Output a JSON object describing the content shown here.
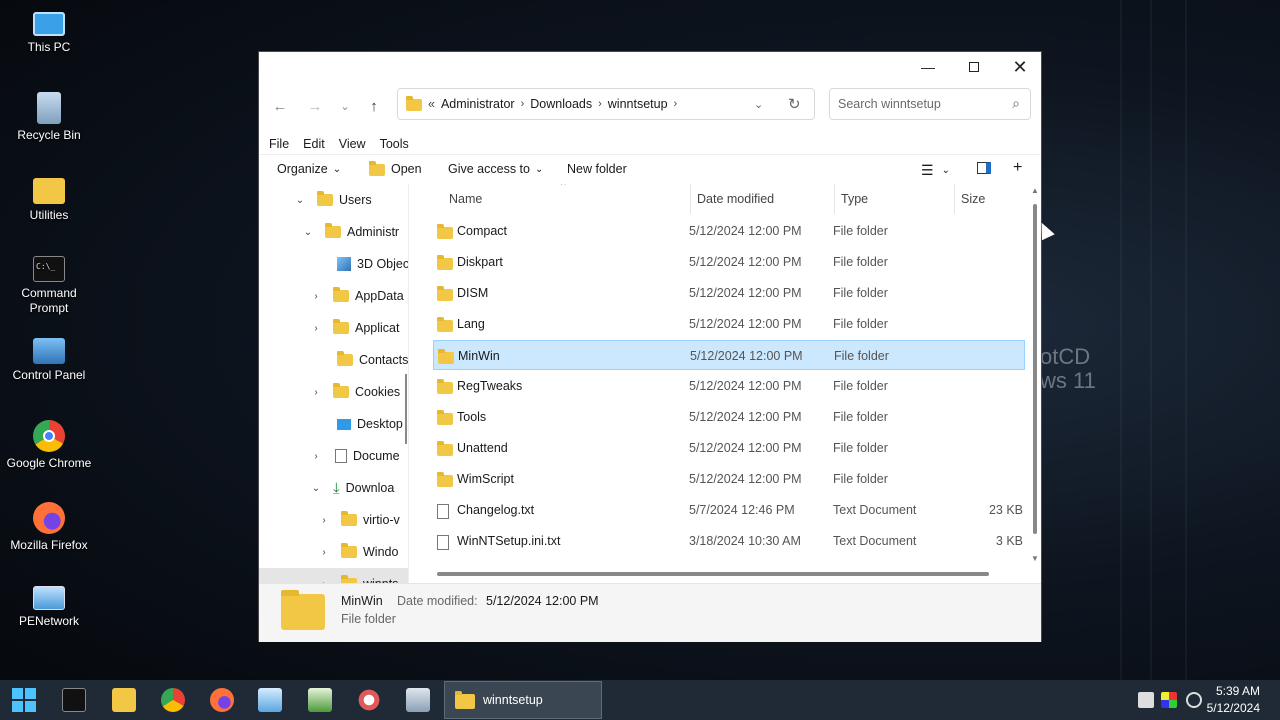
{
  "desktop": {
    "background_text": [
      "otCD",
      "ws 11"
    ],
    "icons": [
      {
        "label": "This PC",
        "icon": "monitor-icon",
        "color": "#3aa0e8"
      },
      {
        "label": "Recycle Bin",
        "icon": "recycle-bin-icon",
        "color": "#8fb4d6"
      },
      {
        "label": "Utilities",
        "icon": "folder-icon",
        "color": "#f3c746"
      },
      {
        "label": "Command Prompt",
        "icon": "terminal-icon",
        "color": "#111111"
      },
      {
        "label": "Control Panel",
        "icon": "control-panel-icon",
        "color": "#3f86c9"
      },
      {
        "label": "Google Chrome",
        "icon": "chrome-icon",
        "color": "#e94235"
      },
      {
        "label": "Mozilla Firefox",
        "icon": "firefox-icon",
        "color": "#ff7139"
      },
      {
        "label": "PENetwork",
        "icon": "network-icon",
        "color": "#4a9ad6"
      }
    ]
  },
  "explorer": {
    "address": {
      "overflow": "«",
      "segments": [
        "Administrator",
        "Downloads",
        "winntsetup"
      ]
    },
    "search_placeholder": "Search winntsetup",
    "menu": [
      "File",
      "Edit",
      "View",
      "Tools"
    ],
    "commands": {
      "organize": "Organize",
      "open": "Open",
      "give_access": "Give access to",
      "new_folder": "New folder"
    },
    "nav_tree": [
      {
        "label": "Users",
        "chev": "⌄",
        "icon": "folder"
      },
      {
        "label": "Administr",
        "chev": "⌄",
        "icon": "folder"
      },
      {
        "label": "3D Objec",
        "chev": "",
        "icon": "cube"
      },
      {
        "label": "AppData",
        "chev": "›",
        "icon": "folder"
      },
      {
        "label": "Applicat",
        "chev": "›",
        "icon": "folder"
      },
      {
        "label": "Contacts",
        "chev": "",
        "icon": "folder"
      },
      {
        "label": "Cookies",
        "chev": "›",
        "icon": "folder"
      },
      {
        "label": "Desktop",
        "chev": "",
        "icon": "desktop"
      },
      {
        "label": "Docume",
        "chev": "›",
        "icon": "folder"
      },
      {
        "label": "Downloa",
        "chev": "⌄",
        "icon": "download"
      },
      {
        "label": "virtio-v",
        "chev": "›",
        "icon": "folder"
      },
      {
        "label": "Windo",
        "chev": "›",
        "icon": "folder"
      },
      {
        "label": "winnts",
        "chev": "›",
        "icon": "folder"
      }
    ],
    "columns": {
      "name": "Name",
      "date": "Date modified",
      "type": "Type",
      "size": "Size"
    },
    "files": [
      {
        "name": "Compact",
        "date": "5/12/2024 12:00 PM",
        "type": "File folder",
        "size": "",
        "kind": "folder"
      },
      {
        "name": "Diskpart",
        "date": "5/12/2024 12:00 PM",
        "type": "File folder",
        "size": "",
        "kind": "folder"
      },
      {
        "name": "DISM",
        "date": "5/12/2024 12:00 PM",
        "type": "File folder",
        "size": "",
        "kind": "folder"
      },
      {
        "name": "Lang",
        "date": "5/12/2024 12:00 PM",
        "type": "File folder",
        "size": "",
        "kind": "folder"
      },
      {
        "name": "MinWin",
        "date": "5/12/2024 12:00 PM",
        "type": "File folder",
        "size": "",
        "kind": "folder",
        "selected": true
      },
      {
        "name": "RegTweaks",
        "date": "5/12/2024 12:00 PM",
        "type": "File folder",
        "size": "",
        "kind": "folder"
      },
      {
        "name": "Tools",
        "date": "5/12/2024 12:00 PM",
        "type": "File folder",
        "size": "",
        "kind": "folder"
      },
      {
        "name": "Unattend",
        "date": "5/12/2024 12:00 PM",
        "type": "File folder",
        "size": "",
        "kind": "folder"
      },
      {
        "name": "WimScript",
        "date": "5/12/2024 12:00 PM",
        "type": "File folder",
        "size": "",
        "kind": "folder"
      },
      {
        "name": "Changelog.txt",
        "date": "5/7/2024 12:46 PM",
        "type": "Text Document",
        "size": "23 KB",
        "kind": "doc"
      },
      {
        "name": "WinNTSetup.ini.txt",
        "date": "3/18/2024 10:30 AM",
        "type": "Text Document",
        "size": "3 KB",
        "kind": "doc"
      }
    ],
    "details": {
      "name": "MinWin",
      "date_label": "Date modified:",
      "date_value": "5/12/2024 12:00 PM",
      "type": "File folder"
    }
  },
  "taskbar": {
    "active_window": "winntsetup",
    "time": "5:39 AM",
    "date": "5/12/2024",
    "pinned": [
      "start-icon",
      "terminal-icon",
      "file-explorer-icon",
      "chrome-icon",
      "firefox-icon",
      "notepad-icon",
      "spreadsheet-icon",
      "paint-icon",
      "calculator-icon"
    ]
  }
}
